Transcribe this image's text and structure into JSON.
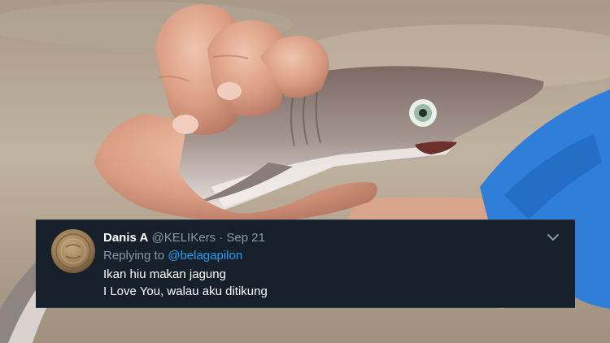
{
  "tweet": {
    "display_name": "Danis A",
    "handle": "@KELIKers",
    "separator": "·",
    "date": "Sep 21",
    "reply_prefix": "Replying to",
    "reply_to": "@belagapilon",
    "lines": [
      "Ikan hiu makan jagung",
      "I Love You, walau aku ditikung"
    ]
  },
  "icons": {
    "avatar": "avatar-coin-icon",
    "menu": "chevron-down-icon"
  },
  "colors": {
    "card_background": "#15202b",
    "primary_text": "#ffffff",
    "secondary_text": "#8899a6",
    "link": "#1da1f2"
  }
}
